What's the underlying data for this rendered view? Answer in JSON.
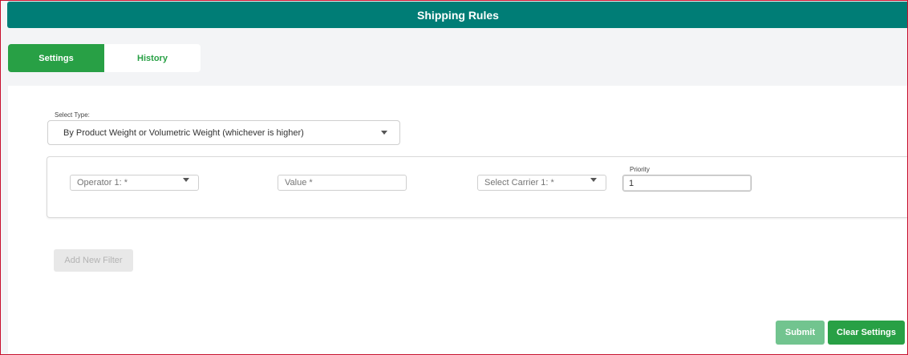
{
  "header": {
    "title": "Shipping Rules"
  },
  "tabs": [
    {
      "label": "Settings",
      "active": true
    },
    {
      "label": "History",
      "active": false
    }
  ],
  "select_type": {
    "label": "Select Type:",
    "value": "By Product Weight or Volumetric Weight (whichever is higher)"
  },
  "filter": {
    "operator_placeholder": "Operator 1: *",
    "value_placeholder": "Value *",
    "carrier_placeholder": "Select Carrier 1: *",
    "priority_label": "Priority",
    "priority_value": "1"
  },
  "buttons": {
    "add_filter": "Add New Filter",
    "submit": "Submit",
    "clear": "Clear Settings"
  },
  "colors": {
    "header_teal": "#007d76",
    "primary_green": "#28a045",
    "submit_disabled_green": "#72c48f",
    "frame_border": "#c8102e"
  }
}
